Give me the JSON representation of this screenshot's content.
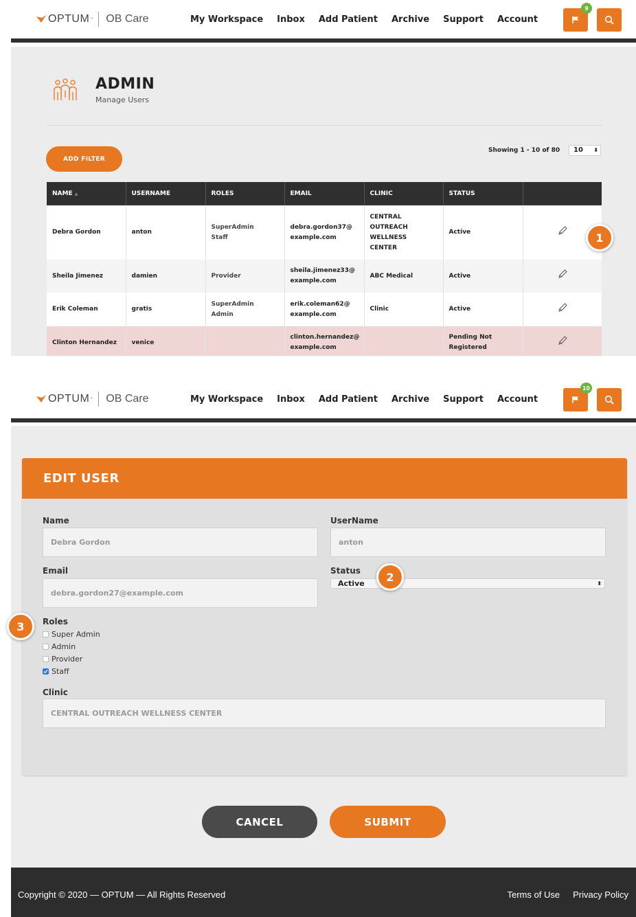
{
  "header1": {
    "brand": "OPTUM",
    "tm": "™",
    "product": "OB Care",
    "nav": [
      "My Workspace",
      "Inbox",
      "Add Patient",
      "Archive",
      "Support",
      "Account"
    ],
    "flag_badge": "9"
  },
  "admin": {
    "title": "ADMIN",
    "subtitle": "Manage Users",
    "add_filter": "ADD FILTER",
    "showing": "Showing 1 - 10 of 80",
    "page_size": "10",
    "columns": [
      "NAME",
      "USERNAME",
      "ROLES",
      "EMAIL",
      "CLINIC",
      "STATUS",
      ""
    ],
    "sort_indicator": "▲",
    "rows": [
      {
        "name": "Debra Gordon",
        "username": "anton",
        "roles": [
          "SuperAdmin",
          "Staff"
        ],
        "email": [
          "debra.gordon37@",
          "example.com"
        ],
        "clinic": [
          "CENTRAL",
          "OUTREACH",
          "WELLNESS",
          "CENTER"
        ],
        "status": [
          "Active"
        ]
      },
      {
        "name": "Sheila Jimenez",
        "username": "damien",
        "roles": [
          "Provider"
        ],
        "email": [
          "sheila.jimenez33@",
          "example.com"
        ],
        "clinic": [
          "ABC Medical"
        ],
        "status": [
          "Active"
        ]
      },
      {
        "name": "Erik Coleman",
        "username": "gratis",
        "roles": [
          "SuperAdmin",
          "Admin"
        ],
        "email": [
          "erik.coleman62@",
          "example.com"
        ],
        "clinic": [
          "Clinic"
        ],
        "status": [
          "Active"
        ]
      },
      {
        "name": "Clinton Hernandez",
        "username": "venice",
        "roles": [],
        "email": [
          "clinton.hernandez@",
          "example.com"
        ],
        "clinic": [],
        "status": [
          "Pending Not",
          "Registered"
        ]
      }
    ]
  },
  "header2": {
    "brand": "OPTUM",
    "tm": "™",
    "product": "OB Care",
    "nav": [
      "My Workspace",
      "Inbox",
      "Add Patient",
      "Archive",
      "Support",
      "Account"
    ],
    "flag_badge": "10"
  },
  "edit": {
    "title": "EDIT USER",
    "name_label": "Name",
    "name_value": "Debra Gordon",
    "username_label": "UserName",
    "username_value": "anton",
    "email_label": "Email",
    "email_value": "debra.gordon27@example.com",
    "status_label": "Status",
    "status_value": "Active",
    "roles_label": "Roles",
    "roles": [
      {
        "label": "Super Admin",
        "checked": false
      },
      {
        "label": "Admin",
        "checked": false
      },
      {
        "label": "Provider",
        "checked": false
      },
      {
        "label": "Staff",
        "checked": true
      }
    ],
    "clinic_label": "Clinic",
    "clinic_value": "CENTRAL OUTREACH WELLNESS CENTER",
    "cancel": "CANCEL",
    "submit": "SUBMIT"
  },
  "callouts": [
    "1",
    "2",
    "3"
  ],
  "footer": {
    "copyright": "Copyright © 2020 — OPTUM — All Rights Reserved",
    "terms": "Terms of Use",
    "privacy": "Privacy Policy"
  },
  "colors": {
    "accent": "#e87722",
    "dark": "#2f2f2f",
    "badge": "#6cb33f",
    "pending_row": "#efd6d4"
  },
  "icons": {
    "flag": "flag-icon",
    "search": "search-icon",
    "edit": "pencil-icon",
    "admin": "users-icon"
  }
}
